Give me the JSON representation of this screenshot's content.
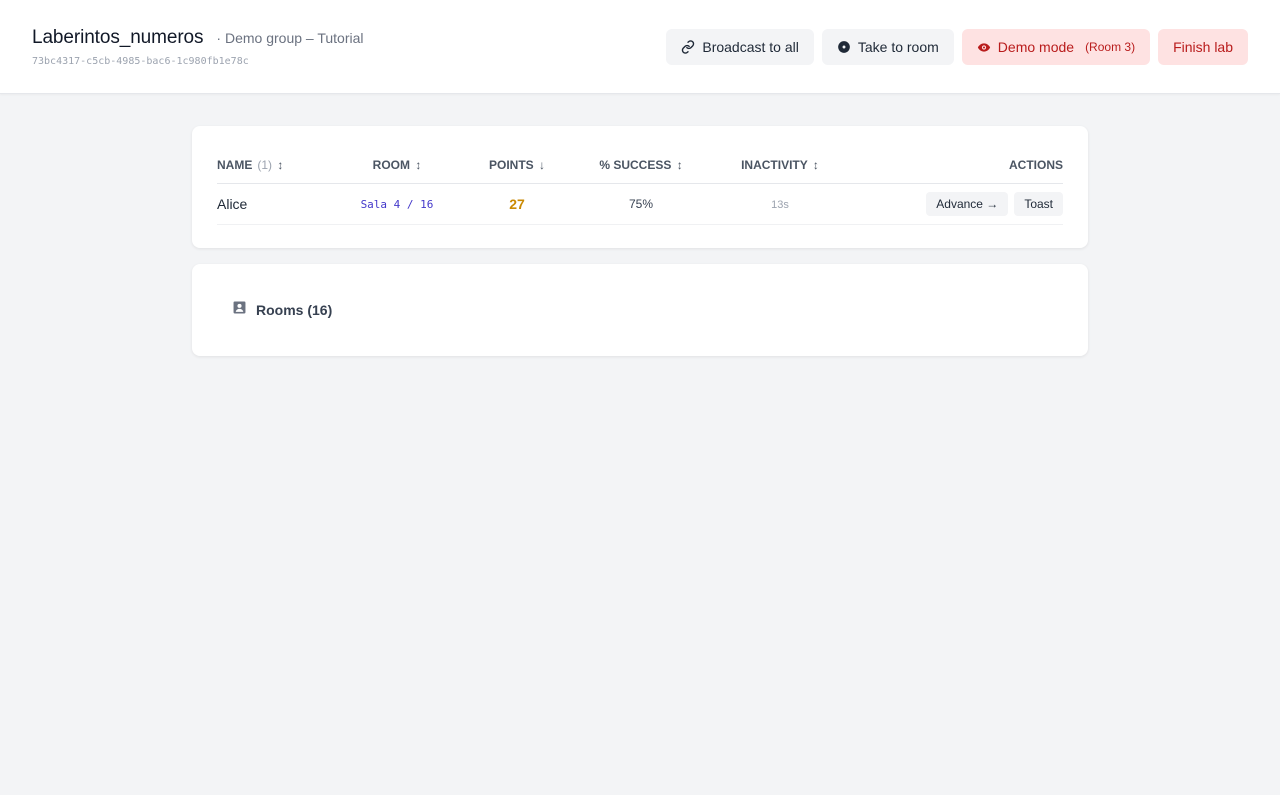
{
  "header": {
    "title": "Laberintos_numeros",
    "subtitle": "· Demo group – Tutorial",
    "session_id": "73bc4317-c5cb-4985-bac6-1c980fb1e78c"
  },
  "toolbar": {
    "broadcast_label": "Broadcast to all",
    "broadcast_icon": "link-icon",
    "take_to_room_label": "Take to room",
    "take_to_room_icon": "dot-circle-icon",
    "demo_mode_label": "Demo mode",
    "demo_mode_room": "(Room 3)",
    "demo_mode_icon": "eye-icon",
    "finish_label": "Finish lab"
  },
  "table": {
    "columns": {
      "name": "NAME",
      "name_count": "(1)",
      "room": "ROOM",
      "points": "POINTS",
      "success": "% SUCCESS",
      "inactivity": "INACTIVITY",
      "actions": "ACTIONS"
    },
    "sort_indicators": {
      "unsorted": "↕",
      "descending": "↓"
    },
    "rows": [
      {
        "name": "Alice",
        "room": "Sala 4 / 16",
        "points": "27",
        "success": "75%",
        "inactivity": "13s",
        "advance_label": "Advance →",
        "toast_label": "Toast"
      }
    ]
  },
  "rooms": {
    "title": "Rooms (16)",
    "icon": "room-badge-icon"
  },
  "colors": {
    "accent_red": "#b91c1c",
    "red_bg": "#fee2e2",
    "points_gold": "#ca8a04",
    "room_indigo": "#4338ca"
  }
}
